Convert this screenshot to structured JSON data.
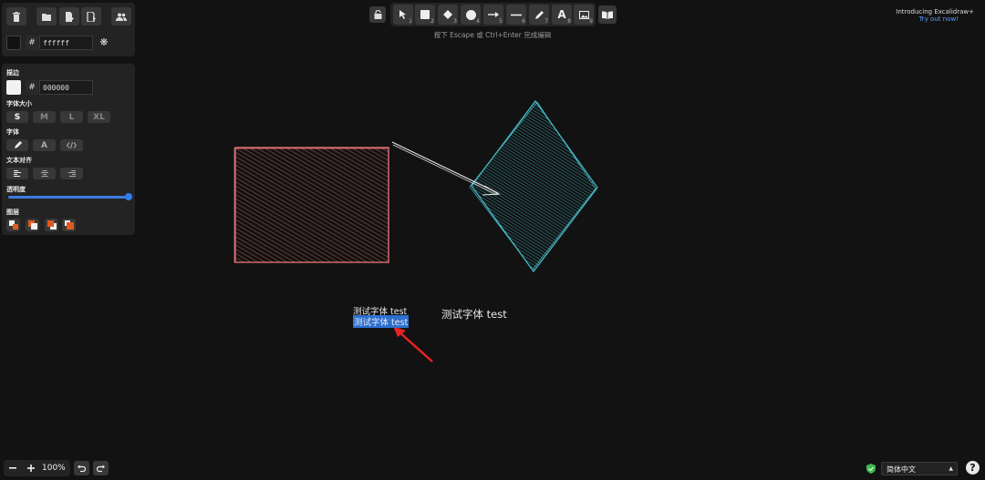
{
  "top_left_toolbar": {
    "icons": [
      "trash-icon",
      "folder-open-icon",
      "export-icon",
      "export-image-icon",
      "collaborators-icon"
    ]
  },
  "background": {
    "hash": "#",
    "hex_value": "ffffff",
    "swatch_color": "#121212"
  },
  "properties": {
    "stroke_label": "描边",
    "stroke_hash": "#",
    "stroke_hex": "000000",
    "stroke_swatch_color": "#ffffff",
    "font_size_label": "字体大小",
    "font_sizes": [
      "S",
      "M",
      "L",
      "XL"
    ],
    "font_family_label": "字体",
    "font_family_letter": "A",
    "text_align_label": "文本对齐",
    "opacity_label": "透明度",
    "opacity_value": 1.0,
    "layers_label": "图层"
  },
  "toolbar": {
    "hint": "按下 Escape 或 Ctrl+Enter 完成编辑",
    "tools": [
      {
        "name": "lock-icon",
        "num": ""
      },
      {
        "name": "selection-tool",
        "num": "1"
      },
      {
        "name": "rectangle-tool",
        "num": "2"
      },
      {
        "name": "diamond-tool",
        "num": "3"
      },
      {
        "name": "ellipse-tool",
        "num": "4"
      },
      {
        "name": "arrow-tool",
        "num": "5"
      },
      {
        "name": "line-tool",
        "num": "6"
      },
      {
        "name": "draw-tool",
        "num": "7"
      },
      {
        "name": "text-tool",
        "num": "8"
      },
      {
        "name": "image-tool",
        "num": "9"
      },
      {
        "name": "library-icon",
        "num": ""
      }
    ],
    "text_tool_letter": "A"
  },
  "promo": {
    "title": "Introducing Excalidraw+",
    "link": "Try out now!"
  },
  "canvas": {
    "text1": "测试字体 test",
    "text2_selected": "测试字体 test",
    "text3": "测试字体 test",
    "rect_color": "#e06c6c",
    "diamond_color": "#3aa6b4",
    "annotation_arrow_color": "#e02020"
  },
  "footer": {
    "zoom": "100%",
    "language": "简体中文",
    "help": "?"
  }
}
